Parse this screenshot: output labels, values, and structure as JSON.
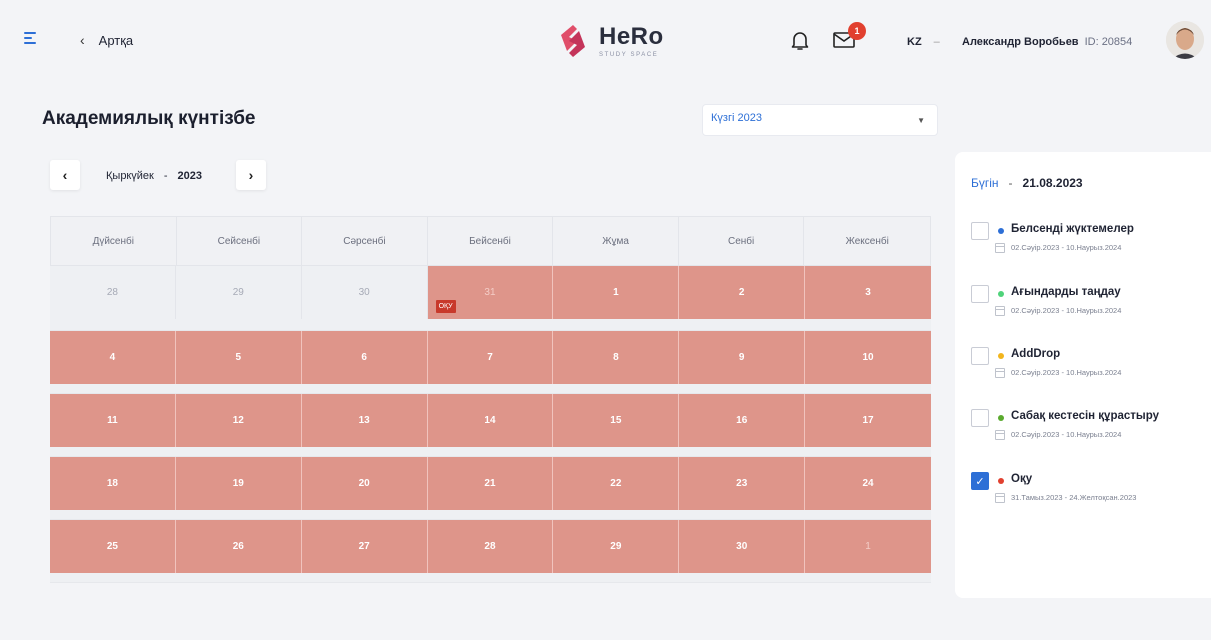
{
  "header": {
    "back_label": "Артқа",
    "logo_title": "HeRo",
    "logo_subtitle": "STUDY SPACE",
    "mail_badge": "1",
    "lang": "KZ",
    "user_name": "Александр Воробьев",
    "user_id": "ID: 20854",
    "colors": {
      "accent": "#2d6fd6",
      "brand": "#e04e6a"
    }
  },
  "main": {
    "title": "Академиялық күнтізбе",
    "semester_select": "Күзгі 2023",
    "month": "Қыркүйек",
    "separator": "-",
    "year": "2023"
  },
  "calendar": {
    "weekdays": [
      "Дүйсенбі",
      "Сейсенбі",
      "Сәрсенбі",
      "Бейсенбі",
      "Жұма",
      "Сенбі",
      "Жексенбі"
    ],
    "weeks": [
      [
        "28",
        "29",
        "30",
        "31",
        "1",
        "2",
        "3"
      ],
      [
        "4",
        "5",
        "6",
        "7",
        "8",
        "9",
        "10"
      ],
      [
        "11",
        "12",
        "13",
        "14",
        "15",
        "16",
        "17"
      ],
      [
        "18",
        "19",
        "20",
        "21",
        "22",
        "23",
        "24"
      ],
      [
        "25",
        "26",
        "27",
        "28",
        "29",
        "30",
        "1"
      ]
    ],
    "event_tag": "ОҚУ",
    "event_color": "#de958a"
  },
  "sidebar": {
    "today_label": "Бүгін",
    "today_sep": "-",
    "today_date": "21.08.2023",
    "events": [
      {
        "title": "Белсенді жүктемелер",
        "range": "02.Сәуір.2023 - 10.Наурыз.2024",
        "color": "#2d6fd6",
        "checked": false
      },
      {
        "title": "Ағындарды таңдау",
        "range": "02.Сәуір.2023 - 10.Наурыз.2024",
        "color": "#4fd37a",
        "checked": false
      },
      {
        "title": "AddDrop",
        "range": "02.Сәуір.2023 - 10.Наурыз.2024",
        "color": "#f2b51d",
        "checked": false
      },
      {
        "title": "Сабақ кестесін құрастыру",
        "range": "02.Сәуір.2023 - 10.Наурыз.2024",
        "color": "#5aaa2e",
        "checked": false
      },
      {
        "title": "Оқу",
        "range": "31.Тамыз.2023 - 24.Желтоқсан.2023",
        "color": "#e1402f",
        "checked": true
      }
    ]
  }
}
